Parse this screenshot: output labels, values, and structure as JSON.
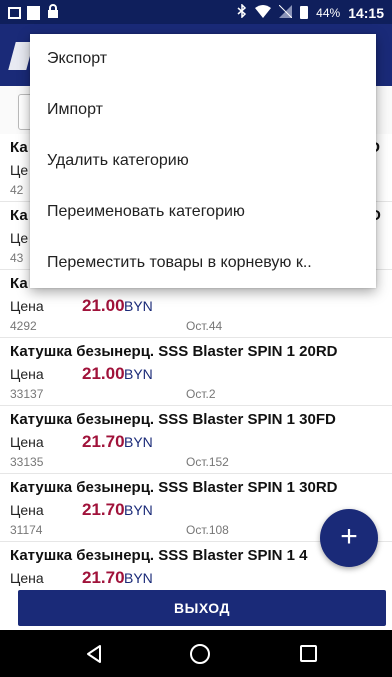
{
  "status_bar": {
    "battery": "44%",
    "time": "14:15"
  },
  "menu": {
    "items": [
      {
        "label": "Экспорт"
      },
      {
        "label": "Импорт"
      },
      {
        "label": "Удалить категорию"
      },
      {
        "label": "Переименовать категорию"
      },
      {
        "label": "Переместить товары в корневую к.."
      }
    ]
  },
  "list": {
    "price_label": "Цена",
    "currency": "BYN",
    "items": [
      {
        "name": "Ка",
        "name_tail": "FD",
        "price": "",
        "code": "42",
        "stock": ""
      },
      {
        "name": "Ка",
        "name_tail": "D",
        "price": "",
        "code": "43",
        "stock": ""
      },
      {
        "name": "Ка",
        "name_tail": "",
        "price": "21.00",
        "code": "4292",
        "stock": "Ост.44"
      },
      {
        "name": "Катушка безынерц. SSS Blaster SPIN 1 20RD",
        "price": "21.00",
        "code": "33137",
        "stock": "Ост.2"
      },
      {
        "name": "Катушка безынерц. SSS Blaster SPIN 1 30FD",
        "price": "21.70",
        "code": "33135",
        "stock": "Ост.152"
      },
      {
        "name": "Катушка безынерц. SSS Blaster SPIN 1 30RD",
        "price": "21.70",
        "code": "31174",
        "stock": "Ост.108"
      },
      {
        "name": "Катушка безынерц. SSS Blaster SPIN 1 4",
        "price": "21.70",
        "code": "",
        "stock": ""
      }
    ]
  },
  "fab": {
    "label": "+"
  },
  "exit_button": {
    "label": "ВЫХОД"
  }
}
